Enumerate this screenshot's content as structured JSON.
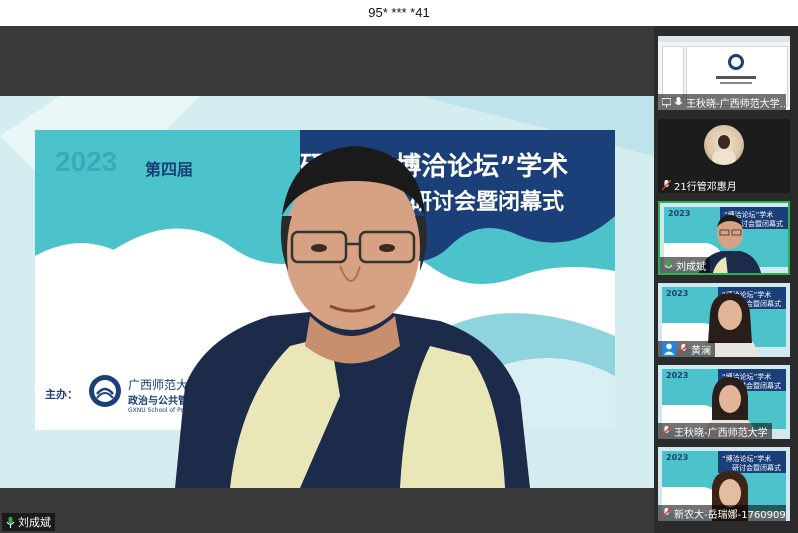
{
  "meeting_id": "95* *** *41",
  "main_speaker": {
    "name": "刘成斌",
    "slide": {
      "year": "2023",
      "edition": "第四届",
      "title_line1": "研究生“博洽论坛”学术",
      "title_line2": "研讨会暨闭幕式",
      "sponsor_label": "主办：",
      "org_name": "广西师范大学",
      "org_dept": "政治与公共管理学院",
      "org_en": "GXNU School of Politics"
    }
  },
  "participants": [
    {
      "name": "王秋晓-广西师范大学...",
      "type": "screen",
      "mic": "on"
    },
    {
      "name": "21行管邓惠月",
      "type": "avatar",
      "mic": "muted"
    },
    {
      "name": "刘成斌",
      "type": "slide-person",
      "mic": "speaking",
      "active": true
    },
    {
      "name": "黄澜",
      "type": "slide-person",
      "mic": "muted",
      "user_icon": true
    },
    {
      "name": "王秋晓-广西师范大学",
      "type": "slide-person",
      "mic": "muted"
    },
    {
      "name": "新农大-岳瑞娜-17609092...",
      "type": "slide-person",
      "mic": "muted"
    }
  ],
  "tile_slide": {
    "year": "2023",
    "line1": "“博洽论坛”学术",
    "line2": "研讨会暨闭幕式"
  },
  "colors": {
    "accent_green": "#2fae4f",
    "slide_navy": "#1b3f78",
    "slide_teal": "#3fb7c4"
  }
}
